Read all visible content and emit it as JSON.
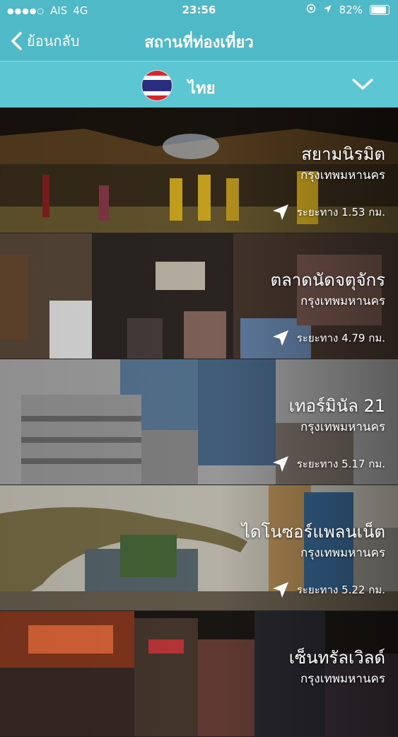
{
  "status_bar": {
    "carrier": "AIS",
    "network": "4G",
    "time": "23:56",
    "battery": "82%"
  },
  "nav": {
    "back_label": "ย้อนกลับ",
    "title": "สถานที่ท่องเที่ยว"
  },
  "country": {
    "name": "ไทย"
  },
  "places": [
    {
      "name": "สยามนิรมิต",
      "city": "กรุงเทพมหานคร",
      "distance": "ระยะทาง  1.53  กม."
    },
    {
      "name": "ตลาดนัดจตุจักร",
      "city": "กรุงเทพมหานคร",
      "distance": "ระยะทาง  4.79  กม."
    },
    {
      "name": "เทอร์มินัล 21",
      "city": "กรุงเทพมหานคร",
      "distance": "ระยะทาง  5.17  กม."
    },
    {
      "name": "ไดโนซอร์แพลนเน็ต",
      "city": "กรุงเทพมหานคร",
      "distance": "ระยะทาง  5.22  กม."
    },
    {
      "name": "เซ็นทรัลเวิลด์",
      "city": "กรุงเทพมหานคร",
      "distance": ""
    }
  ],
  "colors": {
    "header": "#4fb9c8",
    "country_bar": "#5cc6d3"
  },
  "icons": [
    "back-chevron-icon",
    "dropdown-chevron-icon",
    "location-arrow-icon",
    "thai-flag-icon"
  ]
}
